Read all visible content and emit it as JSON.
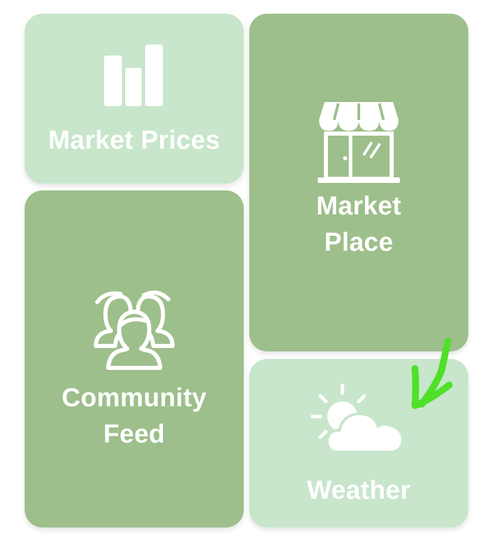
{
  "tiles": {
    "market_prices": {
      "label": "Market Prices",
      "icon": "bar-chart-icon"
    },
    "market_place": {
      "line1": "Market",
      "line2": "Place",
      "icon": "storefront-icon"
    },
    "community_feed": {
      "line1": "Community",
      "line2": "Feed",
      "icon": "people-group-icon"
    },
    "weather": {
      "label": "Weather",
      "icon": "partly-cloudy-icon"
    }
  },
  "colors": {
    "tile_light": "#c8e6cb",
    "tile_dark": "#9dbf8b",
    "annotation": "#4fe02a"
  },
  "annotation": {
    "icon": "green-arrow-annotation"
  }
}
